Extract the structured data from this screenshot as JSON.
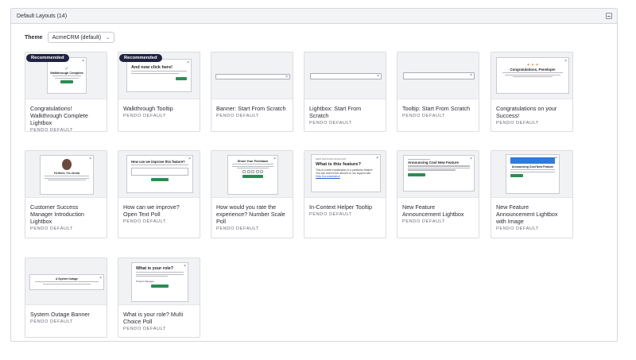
{
  "panel": {
    "title": "Default Layouts (14)"
  },
  "theme": {
    "label": "Theme",
    "selected": "AcmeCRM (default)"
  },
  "cards": [
    {
      "title": "Congratulations! Walkthrough Complete Lightbox",
      "subtitle": "PENDO DEFAULT",
      "badge": "Recommended"
    },
    {
      "title": "Walkthrough Tooltip",
      "subtitle": "PENDO DEFAULT",
      "badge": "Recommended"
    },
    {
      "title": "Banner: Start From Scratch",
      "subtitle": "PENDO DEFAULT"
    },
    {
      "title": "Lightbox: Start From Scratch",
      "subtitle": "PENDO DEFAULT"
    },
    {
      "title": "Tooltip: Start From Scratch",
      "subtitle": "PENDO DEFAULT"
    },
    {
      "title": "Congratulations on your Success!",
      "subtitle": "PENDO DEFAULT"
    },
    {
      "title": "Customer Success Manager Introduction Lightbox",
      "subtitle": "PENDO DEFAULT"
    },
    {
      "title": "How can we improve? Open Text Poll",
      "subtitle": "PENDO DEFAULT"
    },
    {
      "title": "How would you rate the experience? Number Scale Poll",
      "subtitle": "PENDO DEFAULT"
    },
    {
      "title": "In-Context Helper Tooltip",
      "subtitle": "PENDO DEFAULT"
    },
    {
      "title": "New Feature Announcement Lightbox",
      "subtitle": "PENDO DEFAULT"
    },
    {
      "title": "New Feature Announcement Lightbox with Image",
      "subtitle": "PENDO DEFAULT"
    },
    {
      "title": "System Outage Banner",
      "subtitle": "PENDO DEFAULT"
    },
    {
      "title": "What is your role? Multi Choice Poll",
      "subtitle": "PENDO DEFAULT"
    }
  ],
  "previews": {
    "walkthrough_complete": "Walkthrough Complete",
    "walkthrough_tooltip": "And now click here!",
    "congrats": "Congratulations, Penelope!",
    "csm": "Hi there, I'm Jenna",
    "improve": "How can we improve this feature?",
    "rate": "Share Your Feedback",
    "helper_eyebrow": "NEW FEATURE HIGHLIGHT",
    "helper": "What is this feature?",
    "helper_body": "This is a brief explanation of a particular feature. You can learn more about it in our support site.",
    "helper_link": "Help Documentation",
    "new_feature": "Announcing Cool New Feature",
    "new_feature_img": "Announcing Cool New Feature",
    "outage": "A System Outage",
    "role": "What is your role?",
    "role_option": "Product Manager"
  },
  "colors": {
    "accent_green": "#2c8c53",
    "badge_navy": "#1f2340",
    "image_blue": "#2f7bdc"
  }
}
